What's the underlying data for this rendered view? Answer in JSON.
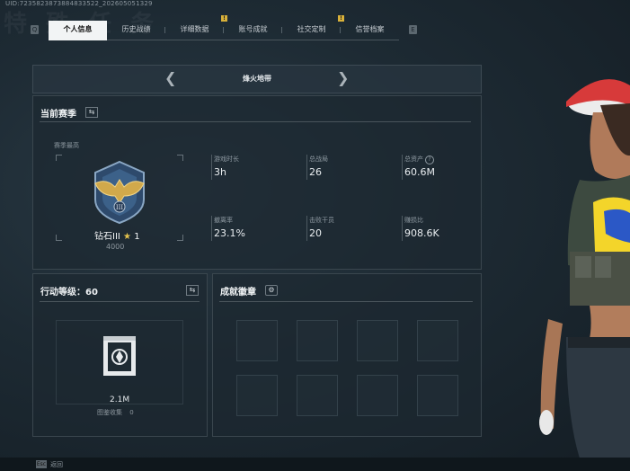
{
  "header": {
    "uid": "UID:7235823873884833522_202605051329",
    "watermark": "特 殊 任 务"
  },
  "nav": {
    "prev_key": "Q",
    "next_key": "E",
    "tabs": [
      {
        "label": "个人信息",
        "active": true,
        "badge": ""
      },
      {
        "label": "历史战绩",
        "active": false,
        "badge": ""
      },
      {
        "label": "详细数据",
        "active": false,
        "badge": "!"
      },
      {
        "label": "账号成就",
        "active": false,
        "badge": ""
      },
      {
        "label": "社交定制",
        "active": false,
        "badge": "!"
      },
      {
        "label": "信誉档案",
        "active": false,
        "badge": ""
      }
    ]
  },
  "map_selector": {
    "title": "烽火地带",
    "prev_icon": "chevron-left-icon",
    "next_icon": "chevron-right-icon"
  },
  "season": {
    "title": "当前赛季",
    "season_best_label": "赛季最高",
    "rank_name": "钻石III",
    "rank_stars": "1",
    "rank_score": "4000",
    "stats": [
      {
        "label": "游戏时长",
        "value": "3h"
      },
      {
        "label": "总战局",
        "value": "26"
      },
      {
        "label": "总资产",
        "value": "60.6M",
        "help": "?"
      },
      {
        "label": "撤离率",
        "value": "23.1%"
      },
      {
        "label": "击败干员",
        "value": "20"
      },
      {
        "label": "赚损比",
        "value": "908.6K"
      }
    ]
  },
  "action_level": {
    "title": "行动等级：60",
    "value": "2.1M",
    "collection_label": "图鉴收集",
    "collection_value": "0"
  },
  "achievements": {
    "title": "成就徽章"
  },
  "footer": {
    "key": "Esc",
    "label": "返回"
  },
  "colors": {
    "accent": "#d8b13a",
    "tab_active_bg": "#f2f4f5",
    "panel_bg": "#1c2830"
  }
}
